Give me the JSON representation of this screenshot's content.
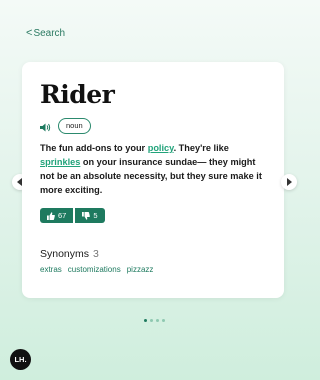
{
  "header": {
    "back_label": "Search"
  },
  "card": {
    "word": "Rider",
    "part_of_speech": "noun",
    "definition": {
      "part1": "The fun add-ons to your ",
      "link1": "policy",
      "part2": ". They're like ",
      "link2": "sprinkles",
      "part3": " on your insurance sundae— they might not be an absolute necessity, but they sure make it more exciting."
    },
    "votes": {
      "up": "67",
      "down": "5"
    },
    "synonyms": {
      "title": "Synonyms",
      "count": "3",
      "items": [
        "extras",
        "customizations",
        "pizzazz"
      ]
    }
  },
  "pagination": {
    "total": 4,
    "active": 1
  },
  "logo": {
    "text": "LH."
  },
  "colors": {
    "accent": "#1e7a5f",
    "link": "#21a37a",
    "background": "#e4f4ec"
  },
  "icons": [
    "chevron-left-icon",
    "speaker-icon",
    "thumbs-up-icon",
    "thumbs-down-icon",
    "chevron-right-icon"
  ]
}
